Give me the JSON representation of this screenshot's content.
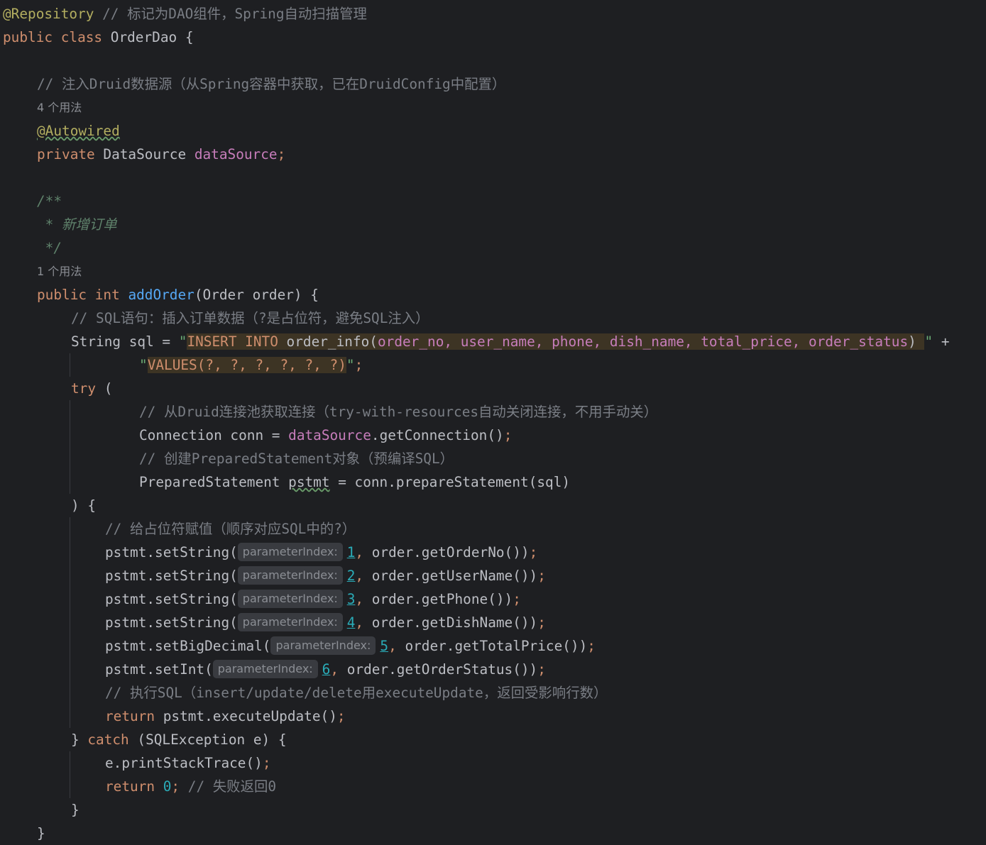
{
  "code": {
    "l1_ann": "@Repository",
    "l1_cm": " // 标记为DAO组件，Spring自动扫描管理",
    "l2_kw": "public class",
    "l2_rest": " OrderDao {",
    "l3_cm": "// 注入Druid数据源（从Spring容器中获取，已在DruidConfig中配置）",
    "usage_1": "4 个用法",
    "l4_ann": "@Autowired",
    "l5_kw": "private",
    "l5_type": " DataSource ",
    "l5_field": "dataSource",
    "l5_semi": ";",
    "doc_1": "/**",
    "doc_2": " * 新增订单",
    "doc_3": " */",
    "usage_2": "1 个用法",
    "m_kw": "public int",
    "m_name": "addOrder",
    "m_params": "(Order order) {",
    "c_sql": "// SQL语句：插入订单数据（?是占位符，避免SQL注入）",
    "sql_lhs": "String sql = ",
    "sql_q1": "\"",
    "sql_kw": "INSERT INTO",
    "sql_tbl": " order_info(",
    "sql_cols": "order_no, user_name, phone, dish_name, total_price, order_status",
    "sql_close": ") ",
    "sql_q2": "\"",
    "sql_plus": " +",
    "sql2_q1": "\"",
    "sql2_body": "VALUES(?, ?, ?, ?, ?, ?)",
    "sql2_q2": "\"",
    "sql2_semi": ";",
    "try_kw": "try",
    "try_paren": " (",
    "c_conn": "// 从Druid连接池获取连接（try-with-resources自动关闭连接，不用手动关）",
    "conn_decl": "Connection conn = ",
    "conn_field": "dataSource",
    "conn_call": ".getConnection()",
    "conn_semi": ";",
    "c_ps": "// 创建PreparedStatement对象（预编译SQL）",
    "ps_type": "PreparedStatement ",
    "ps_var": "pstmt",
    "ps_rest": " = conn.prepareStatement(sql)",
    "close_try": ") {",
    "c_assign": "// 给占位符赋值（顺序对应SQL中的?）",
    "hint_label": "parameterIndex:",
    "set1_call": "pstmt.setString(",
    "set1_idx": "1",
    "set1_rest": " order.getOrderNo())",
    "set2_call": "pstmt.setString(",
    "set2_idx": "2",
    "set2_rest": " order.getUserName())",
    "set3_call": "pstmt.setString(",
    "set3_idx": "3",
    "set3_rest": " order.getPhone())",
    "set4_call": "pstmt.setString(",
    "set4_idx": "4",
    "set4_rest": " order.getDishName())",
    "set5_call": "pstmt.setBigDecimal(",
    "set5_idx": "5",
    "set5_rest": " order.getTotalPrice())",
    "set6_call": "pstmt.setInt(",
    "set6_idx": "6",
    "set6_rest": " order.getOrderStatus())",
    "comma": ",",
    "semi": ";",
    "c_exec": "// 执行SQL（insert/update/delete用executeUpdate，返回受影响行数）",
    "ret_kw": "return",
    "ret_rest": " pstmt.executeUpdate()",
    "catch_open": "} ",
    "catch_kw": "catch",
    "catch_rest": " (SQLException e) {",
    "print_call": "e.printStackTrace()",
    "ret0_kw": "return",
    "ret0_num": " 0",
    "ret0_semi": ";",
    "ret0_cm": " // 失败返回0",
    "brace": "}"
  }
}
